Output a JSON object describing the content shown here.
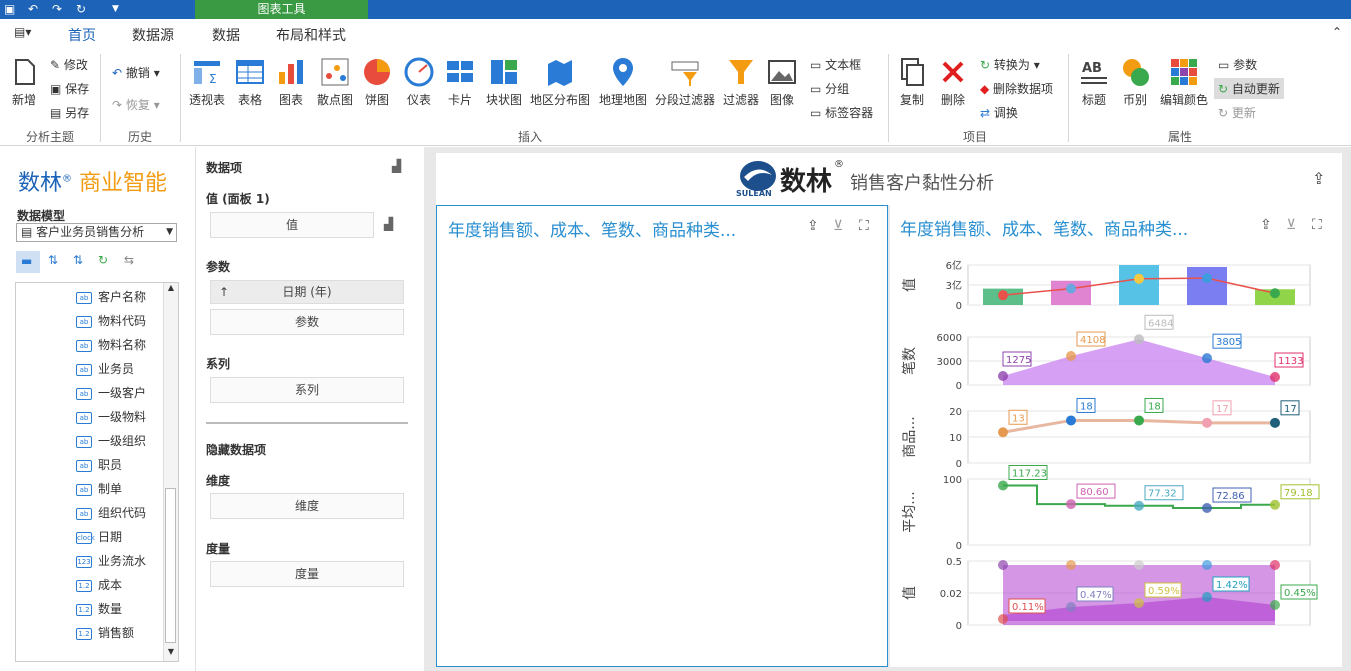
{
  "titlebar": {
    "context_tab": "图表工具"
  },
  "menu": {
    "tabs": [
      "首页",
      "数据源",
      "数据",
      "布局和样式"
    ]
  },
  "ribbon": {
    "new": "新增",
    "edit": "修改",
    "save": "保存",
    "saveas": "另存",
    "g1": "分析主题",
    "undo": "撤销",
    "redo": "恢复",
    "g2": "历史",
    "insert": [
      "透视表",
      "表格",
      "图表",
      "散点图",
      "饼图",
      "仪表",
      "卡片",
      "块状图",
      "地区分布图",
      "地理地图",
      "分段过滤器",
      "过滤器",
      "图像"
    ],
    "textbox": "文本框",
    "group": "分组",
    "tabcontainer": "标签容器",
    "g3": "插入",
    "copy": "复制",
    "delete": "删除",
    "convert": "转换为",
    "deldata": "删除数据项",
    "swap": "调换",
    "g4": "项目",
    "title": "标题",
    "currency": "币别",
    "editcolor": "编辑颜色",
    "param": "参数",
    "autoupdate": "自动更新",
    "update": "更新",
    "g5": "属性"
  },
  "left": {
    "brand1": "数林",
    "brand2": "商业智能",
    "model_label": "数据模型",
    "model_value": "客户业务员销售分析",
    "fields": [
      {
        "type": "ab",
        "name": "客户名称"
      },
      {
        "type": "ab",
        "name": "物料代码"
      },
      {
        "type": "ab",
        "name": "物料名称"
      },
      {
        "type": "ab",
        "name": "业务员"
      },
      {
        "type": "ab",
        "name": "一级客户"
      },
      {
        "type": "ab",
        "name": "一级物料"
      },
      {
        "type": "ab",
        "name": "一级组织"
      },
      {
        "type": "ab",
        "name": "职员"
      },
      {
        "type": "ab",
        "name": "制单"
      },
      {
        "type": "ab",
        "name": "组织代码"
      },
      {
        "type": "clock",
        "name": "日期"
      },
      {
        "type": "123",
        "name": "业务流水"
      },
      {
        "type": "1.2",
        "name": "成本"
      },
      {
        "type": "1.2",
        "name": "数量"
      },
      {
        "type": "1.2",
        "name": "销售额"
      }
    ]
  },
  "fieldpane": {
    "title": "数据项",
    "values_head": "值 (面板 1)",
    "values_box": "值",
    "param_head": "参数",
    "param_item": "日期 (年)",
    "param_box": "参数",
    "series_head": "系列",
    "series_box": "系列",
    "hidden_head": "隐藏数据项",
    "dim_head": "维度",
    "dim_box": "维度",
    "measure_head": "度量",
    "measure_box": "度量"
  },
  "dashboard": {
    "logo_text": "数林",
    "logo_sub": "SULEAN",
    "title": "销售客户黏性分析",
    "panel_left_title": "年度销售额、成本、笔数、商品种类...",
    "panel_right_title": "年度销售额、成本、笔数、商品种类..."
  },
  "chart_data": [
    {
      "type": "bar",
      "ylabel": "值",
      "yticks": [
        "6亿",
        "3亿",
        "0"
      ],
      "values": [
        2.5,
        3.7,
        6.1,
        5.8,
        2.4
      ],
      "line": [
        1.5,
        2.5,
        4.0,
        4.1,
        1.8
      ],
      "colors": [
        "#5cbf8a",
        "#e083d0",
        "#56c3e6",
        "#7b7ef0",
        "#90d44a"
      ],
      "dot_colors": [
        "#e9514b",
        "#6aa6e0",
        "#f5c842",
        "#3f9be0",
        "#3aa84c"
      ]
    },
    {
      "type": "area",
      "ylabel": "笔数",
      "yticks": [
        "6000",
        "3000",
        "0"
      ],
      "values": [
        1275,
        4108,
        6484,
        3805,
        1133
      ],
      "color": "#c882f0",
      "label_colors": [
        "#8e44ad",
        "#e69a50",
        "#bbbbbb",
        "#2a7bd5",
        "#e0306a"
      ]
    },
    {
      "type": "line",
      "ylabel": "商品...",
      "yticks": [
        "20",
        "10",
        "0"
      ],
      "values": [
        13,
        18,
        18,
        17,
        17
      ],
      "color": "#e8b7a0",
      "label_colors": [
        "#e69a50",
        "#2a7bd5",
        "#3aa84c",
        "#f0a0b0",
        "#1f5f7a"
      ]
    },
    {
      "type": "step",
      "ylabel": "平均...",
      "yticks": [
        "100",
        "0"
      ],
      "values": [
        117.23,
        80.6,
        77.32,
        72.86,
        79.18
      ],
      "color": "#3aa84c",
      "label_colors": [
        "#3aa84c",
        "#d060b0",
        "#4aaac0",
        "#4060b0",
        "#a0c030"
      ]
    },
    {
      "type": "area",
      "ylabel": "值",
      "yticks": [
        "0.5",
        "0.02",
        "0"
      ],
      "labels": [
        "0.11%",
        "0.47%",
        "0.59%",
        "1.42%",
        "0.45%"
      ],
      "color": "#b040d0",
      "label_colors": [
        "#e05050",
        "#8080c0",
        "#d0c040",
        "#20a0c0",
        "#3aa84c"
      ]
    }
  ]
}
